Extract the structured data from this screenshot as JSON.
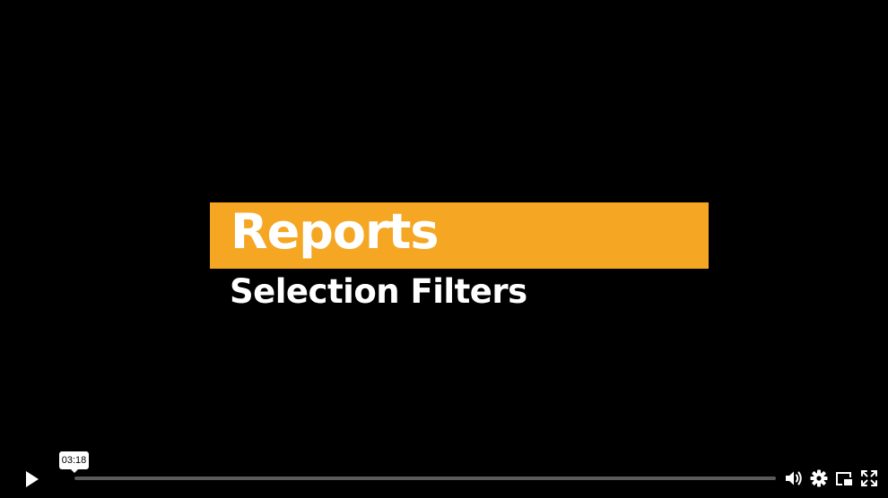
{
  "video": {
    "title": "Reports",
    "subtitle": "Selection Filters",
    "accent_color": "#f5a623"
  },
  "controls": {
    "play_icon": "play-icon",
    "hover_time": "03:18",
    "progress_percent": 0,
    "volume_icon": "volume-icon",
    "settings_icon": "gear-icon",
    "pip_icon": "picture-in-picture-icon",
    "fullscreen_icon": "fullscreen-icon"
  }
}
